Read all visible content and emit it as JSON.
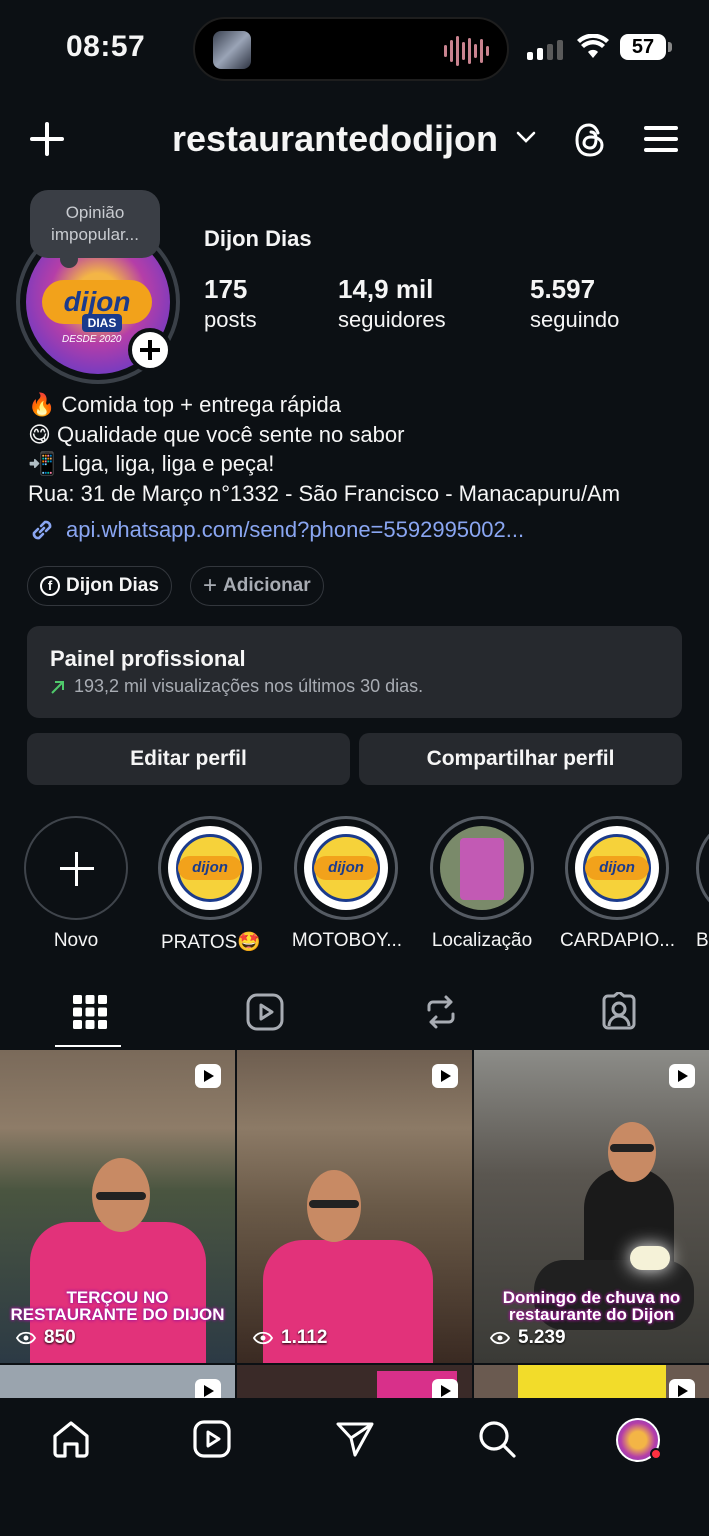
{
  "status_bar": {
    "time": "08:57",
    "battery": "57"
  },
  "header": {
    "username": "restaurantedodijon"
  },
  "profile": {
    "note": "Opinião impopular...",
    "full_name": "Dijon Dias",
    "stats": [
      {
        "value": "175",
        "label": "posts"
      },
      {
        "value": "14,9 mil",
        "label": "seguidores"
      },
      {
        "value": "5.597",
        "label": "seguindo"
      }
    ],
    "bio": [
      "🔥 Comida top + entrega rápida",
      "😋 Qualidade que você sente no sabor",
      "📲 Liga, liga, liga e peça!",
      "Rua: 31 de Março n°1332 - São Francisco - Manacapuru/Am"
    ],
    "link": "api.whatsapp.com/send?phone=5592995002...",
    "chips": {
      "facebook": "Dijon Dias",
      "add": "Adicionar"
    }
  },
  "dashboard": {
    "title": "Painel profissional",
    "subtitle": "193,2 mil visualizações nos últimos 30 dias."
  },
  "buttons": {
    "edit": "Editar perfil",
    "share": "Compartilhar perfil"
  },
  "highlights": [
    {
      "label": "Novo"
    },
    {
      "label": "PRATOS🤩"
    },
    {
      "label": "MOTOBOY..."
    },
    {
      "label": "Localização"
    },
    {
      "label": "CARDAPIO..."
    },
    {
      "label": "B"
    }
  ],
  "posts": [
    {
      "views": "850",
      "caption": "TERÇOU NO RESTAURANTE DO DIJON"
    },
    {
      "views": "1.112",
      "caption": ""
    },
    {
      "views": "5.239",
      "caption": "Domingo de chuva no restaurante do Dijon"
    }
  ],
  "colors": {
    "background": "#0c1014",
    "card": "#26292e",
    "link": "#8aa6f2",
    "accent_pink": "#e2327a"
  }
}
